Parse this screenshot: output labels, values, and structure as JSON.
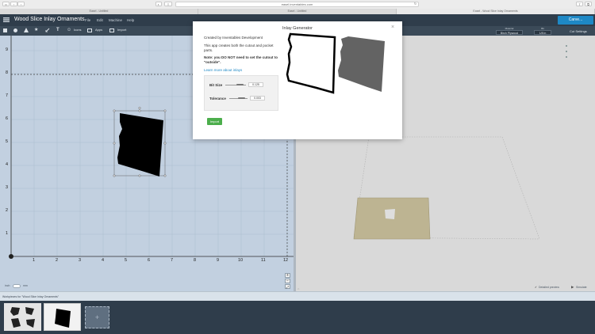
{
  "browser": {
    "address": "easel.inventables.com",
    "tabs": [
      "Easel - Untitled",
      "Easel - Untitled",
      "Easel - Wood Slice Inlay Ornaments"
    ]
  },
  "app": {
    "title": "Wood Slice Inlay Ornaments",
    "menu": [
      "File",
      "Edit",
      "Machine",
      "Help"
    ],
    "carve_button": "Carve..."
  },
  "toolbar": {
    "tools": [
      "Icons",
      "Apps",
      "Import"
    ],
    "material_label": "Material",
    "material_value": "Birch Plywood",
    "bit_label": "Bit",
    "bit_value": "1/8 in",
    "cut_settings": "Cut Settings"
  },
  "dialog": {
    "title": "Inlay Generator",
    "created_by": "Created by Inventables Development",
    "description": "This app creates both the cutout and pocket parts.",
    "note": "Note: you DO NOT need to set the cutout to \"outside\".",
    "learn_more": "Learn more about inlays",
    "bit_size_label": "Bit Size",
    "bit_size_value": "0.125",
    "tolerance_label": "Tolerance",
    "tolerance_value": "0.003",
    "import_label": "Import"
  },
  "ruler": {
    "x": [
      "1",
      "2",
      "3",
      "4",
      "5",
      "6",
      "7",
      "8",
      "9",
      "10",
      "11",
      "12"
    ],
    "y": [
      "9",
      "8",
      "7",
      "6",
      "5",
      "4",
      "3",
      "2",
      "1"
    ]
  },
  "status": {
    "unit_in": "inch",
    "unit_mm": "mm",
    "workpieces": "Workpieces for \"Wood Slice Inlay Ornaments\"",
    "detailed_preview": "Detailed preview",
    "simulate": "Simulate"
  },
  "colors": {
    "header": "#2f3d4b",
    "carve_blue": "#1e88c5",
    "import_green": "#4cae4c",
    "design_canvas": "#cfdeee",
    "material": "#c9c09c"
  }
}
